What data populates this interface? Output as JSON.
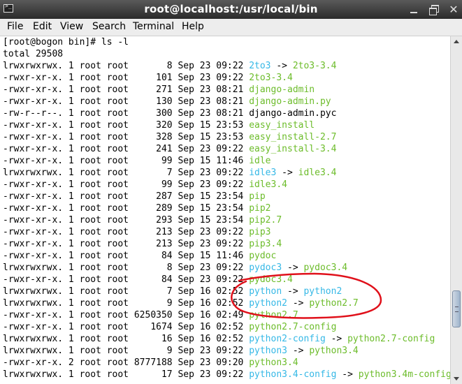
{
  "window": {
    "title": "root@localhost:/usr/local/bin"
  },
  "menu": [
    "File",
    "Edit",
    "View",
    "Search",
    "Terminal",
    "Help"
  ],
  "colors": {
    "executable": "#6cbc2a",
    "symlink": "#35b8e6",
    "annotation": "#e0101a"
  },
  "terminal": {
    "prompt": "[root@bogon bin]# ls -l",
    "total": "total 29508",
    "rows": [
      {
        "perm": "lrwxrwxrwx.",
        "links": "1",
        "owner": "root",
        "group": "root",
        "size": "8",
        "date": "Sep 23 09:22",
        "name": "2to3",
        "kind": "lnk",
        "target": "2to3-3.4",
        "tkind": "exe"
      },
      {
        "perm": "-rwxr-xr-x.",
        "links": "1",
        "owner": "root",
        "group": "root",
        "size": "101",
        "date": "Sep 23 09:22",
        "name": "2to3-3.4",
        "kind": "exe"
      },
      {
        "perm": "-rwxr-xr-x.",
        "links": "1",
        "owner": "root",
        "group": "root",
        "size": "271",
        "date": "Sep 23 08:21",
        "name": "django-admin",
        "kind": "exe"
      },
      {
        "perm": "-rwxr-xr-x.",
        "links": "1",
        "owner": "root",
        "group": "root",
        "size": "130",
        "date": "Sep 23 08:21",
        "name": "django-admin.py",
        "kind": "exe"
      },
      {
        "perm": "-rw-r--r--.",
        "links": "1",
        "owner": "root",
        "group": "root",
        "size": "300",
        "date": "Sep 23 08:21",
        "name": "django-admin.pyc",
        "kind": "plain"
      },
      {
        "perm": "-rwxr-xr-x.",
        "links": "1",
        "owner": "root",
        "group": "root",
        "size": "320",
        "date": "Sep 15 23:53",
        "name": "easy_install",
        "kind": "exe"
      },
      {
        "perm": "-rwxr-xr-x.",
        "links": "1",
        "owner": "root",
        "group": "root",
        "size": "328",
        "date": "Sep 15 23:53",
        "name": "easy_install-2.7",
        "kind": "exe"
      },
      {
        "perm": "-rwxr-xr-x.",
        "links": "1",
        "owner": "root",
        "group": "root",
        "size": "241",
        "date": "Sep 23 09:22",
        "name": "easy_install-3.4",
        "kind": "exe"
      },
      {
        "perm": "-rwxr-xr-x.",
        "links": "1",
        "owner": "root",
        "group": "root",
        "size": "99",
        "date": "Sep 15 11:46",
        "name": "idle",
        "kind": "exe"
      },
      {
        "perm": "lrwxrwxrwx.",
        "links": "1",
        "owner": "root",
        "group": "root",
        "size": "7",
        "date": "Sep 23 09:22",
        "name": "idle3",
        "kind": "lnk",
        "target": "idle3.4",
        "tkind": "exe"
      },
      {
        "perm": "-rwxr-xr-x.",
        "links": "1",
        "owner": "root",
        "group": "root",
        "size": "99",
        "date": "Sep 23 09:22",
        "name": "idle3.4",
        "kind": "exe"
      },
      {
        "perm": "-rwxr-xr-x.",
        "links": "1",
        "owner": "root",
        "group": "root",
        "size": "287",
        "date": "Sep 15 23:54",
        "name": "pip",
        "kind": "exe"
      },
      {
        "perm": "-rwxr-xr-x.",
        "links": "1",
        "owner": "root",
        "group": "root",
        "size": "289",
        "date": "Sep 15 23:54",
        "name": "pip2",
        "kind": "exe"
      },
      {
        "perm": "-rwxr-xr-x.",
        "links": "1",
        "owner": "root",
        "group": "root",
        "size": "293",
        "date": "Sep 15 23:54",
        "name": "pip2.7",
        "kind": "exe"
      },
      {
        "perm": "-rwxr-xr-x.",
        "links": "1",
        "owner": "root",
        "group": "root",
        "size": "213",
        "date": "Sep 23 09:22",
        "name": "pip3",
        "kind": "exe"
      },
      {
        "perm": "-rwxr-xr-x.",
        "links": "1",
        "owner": "root",
        "group": "root",
        "size": "213",
        "date": "Sep 23 09:22",
        "name": "pip3.4",
        "kind": "exe"
      },
      {
        "perm": "-rwxr-xr-x.",
        "links": "1",
        "owner": "root",
        "group": "root",
        "size": "84",
        "date": "Sep 15 11:46",
        "name": "pydoc",
        "kind": "exe"
      },
      {
        "perm": "lrwxrwxrwx.",
        "links": "1",
        "owner": "root",
        "group": "root",
        "size": "8",
        "date": "Sep 23 09:22",
        "name": "pydoc3",
        "kind": "lnk",
        "target": "pydoc3.4",
        "tkind": "exe"
      },
      {
        "perm": "-rwxr-xr-x.",
        "links": "1",
        "owner": "root",
        "group": "root",
        "size": "84",
        "date": "Sep 23 09:22",
        "name": "pydoc3.4",
        "kind": "exe"
      },
      {
        "perm": "lrwxrwxrwx.",
        "links": "1",
        "owner": "root",
        "group": "root",
        "size": "7",
        "date": "Sep 16 02:52",
        "name": "python",
        "kind": "lnk",
        "target": "python2",
        "tkind": "lnk"
      },
      {
        "perm": "lrwxrwxrwx.",
        "links": "1",
        "owner": "root",
        "group": "root",
        "size": "9",
        "date": "Sep 16 02:52",
        "name": "python2",
        "kind": "lnk",
        "target": "python2.7",
        "tkind": "exe"
      },
      {
        "perm": "-rwxr-xr-x.",
        "links": "1",
        "owner": "root",
        "group": "root",
        "size": "6250350",
        "date": "Sep 16 02:49",
        "name": "python2.7",
        "kind": "exe"
      },
      {
        "perm": "-rwxr-xr-x.",
        "links": "1",
        "owner": "root",
        "group": "root",
        "size": "1674",
        "date": "Sep 16 02:52",
        "name": "python2.7-config",
        "kind": "exe"
      },
      {
        "perm": "lrwxrwxrwx.",
        "links": "1",
        "owner": "root",
        "group": "root",
        "size": "16",
        "date": "Sep 16 02:52",
        "name": "python2-config",
        "kind": "lnk",
        "target": "python2.7-config",
        "tkind": "exe"
      },
      {
        "perm": "lrwxrwxrwx.",
        "links": "1",
        "owner": "root",
        "group": "root",
        "size": "9",
        "date": "Sep 23 09:22",
        "name": "python3",
        "kind": "lnk",
        "target": "python3.4",
        "tkind": "exe"
      },
      {
        "perm": "-rwxr-xr-x.",
        "links": "2",
        "owner": "root",
        "group": "root",
        "size": "8777188",
        "date": "Sep 23 09:20",
        "name": "python3.4",
        "kind": "exe"
      },
      {
        "perm": "lrwxrwxrwx.",
        "links": "1",
        "owner": "root",
        "group": "root",
        "size": "17",
        "date": "Sep 23 09:22",
        "name": "python3.4-config",
        "kind": "lnk",
        "target": "python3.4m-config",
        "tkind": "exe"
      }
    ]
  }
}
